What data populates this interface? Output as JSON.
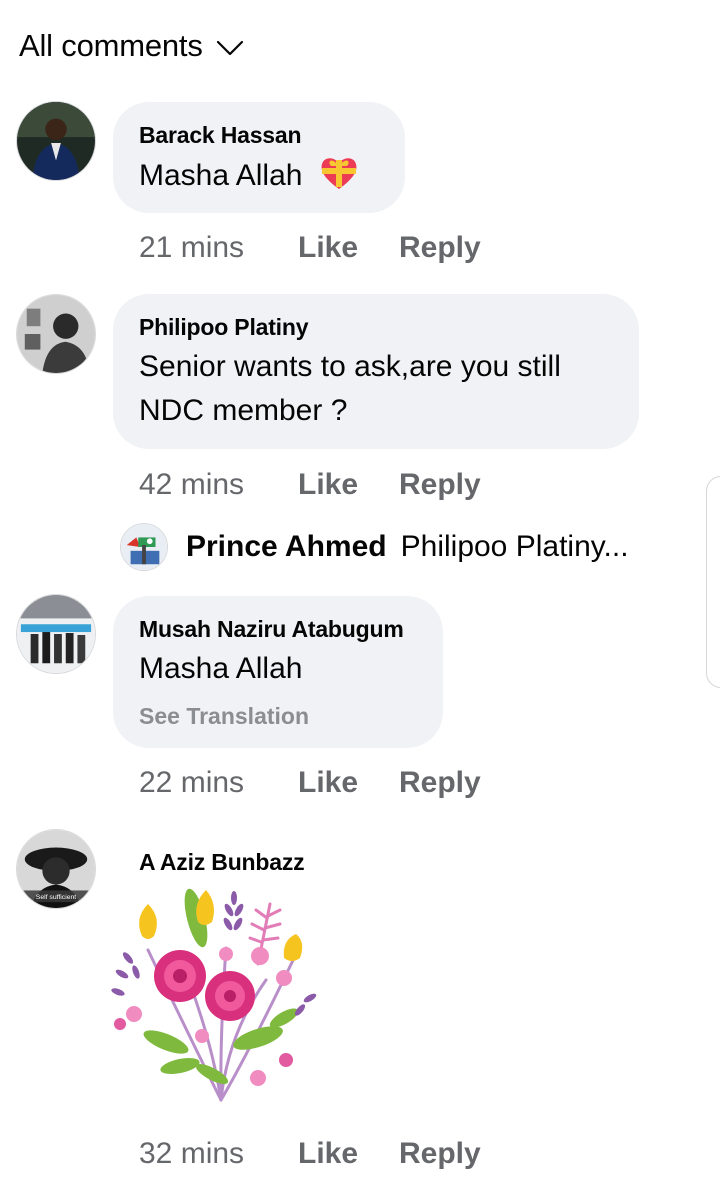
{
  "header": {
    "title": "All comments",
    "chevron_icon": "chevron-down-icon"
  },
  "comments": [
    {
      "author": "Barack Hassan",
      "text": "Masha Allah",
      "emoji": "gift-heart-emoji",
      "time": "21 mins",
      "like": "Like",
      "reply": "Reply"
    },
    {
      "author": "Philipoo Platiny",
      "text_lines": [
        "Senior wants to ask,are you still",
        "NDC member ?"
      ],
      "time": "42 mins",
      "like": "Like",
      "reply": "Reply",
      "replies_preview": {
        "author": "Prince Ahmed",
        "text": "Philipoo Platiny..."
      }
    },
    {
      "author": "Musah Naziru Atabugum",
      "text": "Masha Allah",
      "see_translation": "See Translation",
      "time": "22 mins",
      "like": "Like",
      "reply": "Reply"
    },
    {
      "author": "A Aziz Bunbazz",
      "sticker": "flower-bouquet-sticker",
      "avatar_caption": "Self sufficient",
      "time": "32 mins",
      "like": "Like",
      "reply": "Reply"
    }
  ],
  "colors": {
    "bubble": "#f0f2f5",
    "meta_text": "#65676b",
    "translation": "#8a8d91",
    "text": "#050505"
  }
}
